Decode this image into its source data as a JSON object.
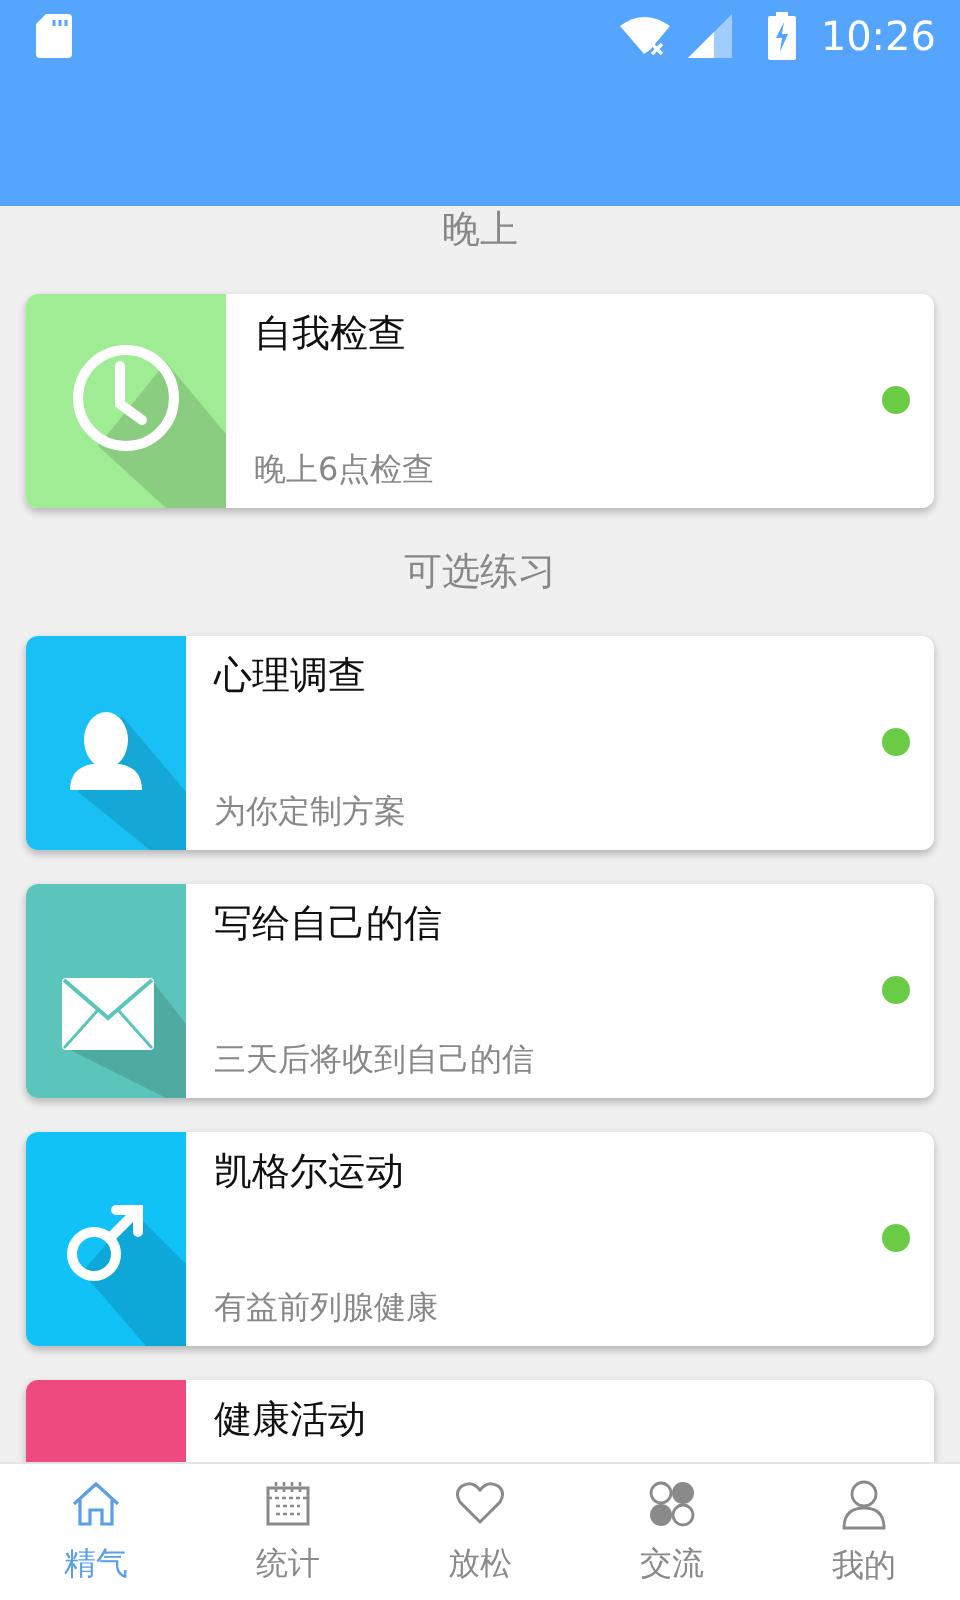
{
  "status_bar": {
    "time": "10:26"
  },
  "sections": [
    {
      "title": "晚上",
      "kind": "wide",
      "cards": [
        {
          "kind": "clock",
          "color": "#a0ec94",
          "title": "自我检查",
          "subtitle": "晚上6点检查",
          "dot": {
            "color": "#6acb45"
          }
        }
      ]
    },
    {
      "title": "可选练习",
      "kind": "narrow",
      "cards": [
        {
          "kind": "person",
          "color": "#19c0f5",
          "title": "心理调查",
          "subtitle": "为你定制方案",
          "dot": {
            "color": "#6acb45"
          }
        },
        {
          "kind": "mail",
          "color": "#5bc4bb",
          "title": "写给自己的信",
          "subtitle": "三天后将收到自己的信",
          "dot": {
            "color": "#6acb45"
          }
        },
        {
          "kind": "male",
          "color": "#10c2f8",
          "title": "凯格尔运动",
          "subtitle": "有益前列腺健康",
          "dot": {
            "color": "#6acb45"
          }
        },
        {
          "kind": "none",
          "color": "#ef4a80",
          "title": "健康活动"
        }
      ]
    }
  ],
  "nav": [
    {
      "kind": "home",
      "label": "精气",
      "selected": true
    },
    {
      "kind": "calendar",
      "label": "统计",
      "selected": false
    },
    {
      "kind": "heart",
      "label": "放松",
      "selected": false
    },
    {
      "kind": "clover",
      "label": "交流",
      "selected": false
    },
    {
      "kind": "user",
      "label": "我的",
      "selected": false
    }
  ]
}
